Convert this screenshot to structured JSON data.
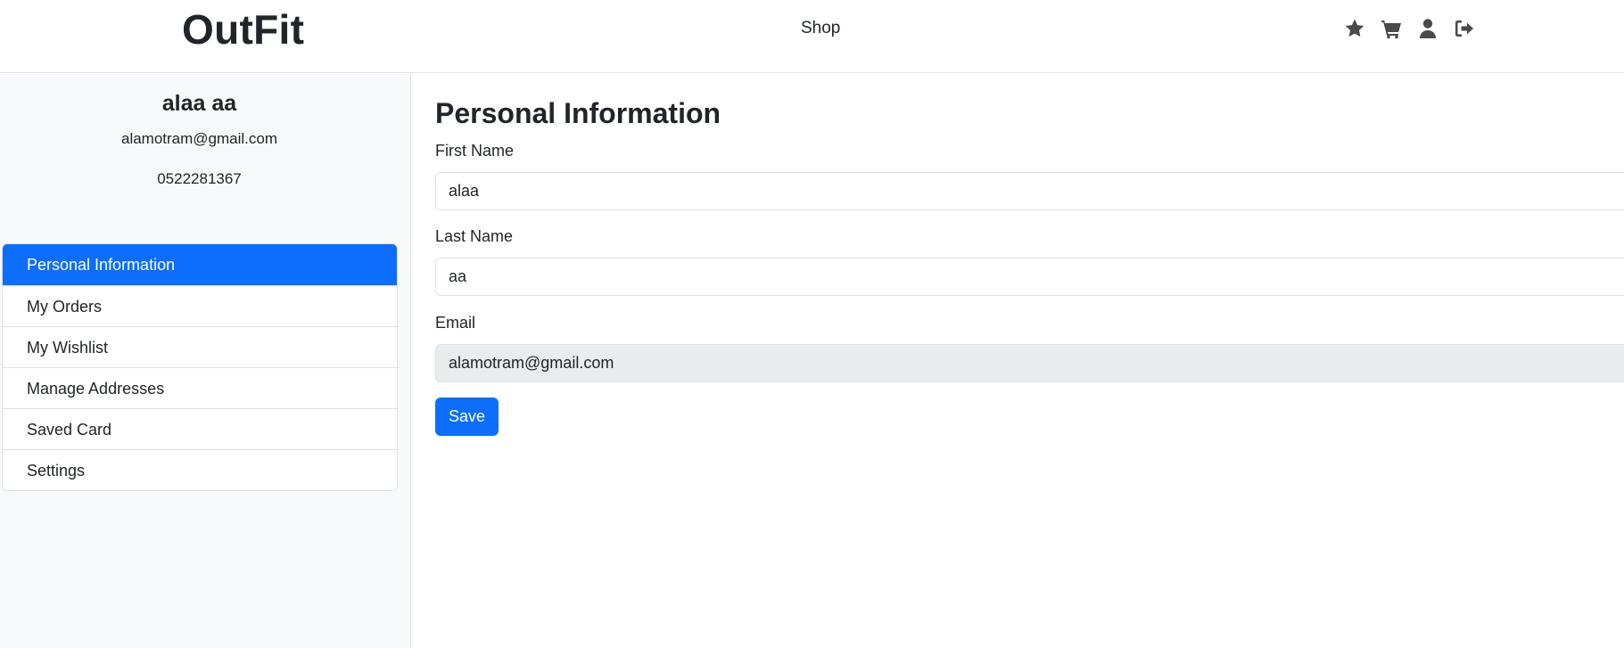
{
  "navbar": {
    "brand": "OutFit",
    "links": [
      {
        "label": "Shop"
      }
    ],
    "icons": [
      "star-icon",
      "cart-icon",
      "user-icon",
      "logout-icon"
    ]
  },
  "sidebar": {
    "profile": {
      "name": "alaa aa",
      "email": "alamotram@gmail.com",
      "phone": "0522281367"
    },
    "items": [
      {
        "label": "Personal Information",
        "active": true
      },
      {
        "label": "My Orders",
        "active": false
      },
      {
        "label": "My Wishlist",
        "active": false
      },
      {
        "label": "Manage Addresses",
        "active": false
      },
      {
        "label": "Saved Card",
        "active": false
      },
      {
        "label": "Settings",
        "active": false
      }
    ]
  },
  "main": {
    "title": "Personal Information",
    "fields": [
      {
        "label": "First Name",
        "value": "alaa",
        "disabled": false
      },
      {
        "label": "Last Name",
        "value": "aa",
        "disabled": false
      },
      {
        "label": "Email",
        "value": "alamotram@gmail.com",
        "disabled": true
      }
    ],
    "save_label": "Save"
  },
  "colors": {
    "primary": "#0d6efd",
    "sidebar_bg": "#f8f9fa",
    "disabled_bg": "#e9ecef",
    "icon": "#4a4a4a"
  }
}
